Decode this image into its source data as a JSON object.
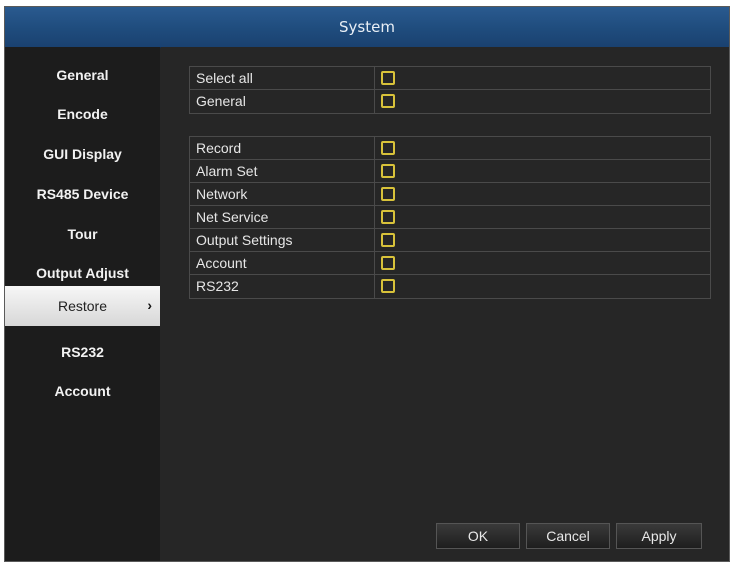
{
  "window": {
    "title": "System"
  },
  "sidebar": {
    "items": [
      {
        "label": "General"
      },
      {
        "label": "Encode"
      },
      {
        "label": "GUI Display"
      },
      {
        "label": "RS485 Device"
      },
      {
        "label": "Tour"
      },
      {
        "label": "Output Adjust"
      },
      {
        "label": "Restore",
        "active": true
      },
      {
        "label": "RS232"
      },
      {
        "label": "Account"
      }
    ],
    "active_chevron": "›"
  },
  "options_top": [
    {
      "label": "Select all",
      "checked": false
    },
    {
      "label": "General",
      "checked": false
    }
  ],
  "options_main": [
    {
      "label": "Record",
      "checked": false
    },
    {
      "label": "Alarm Set",
      "checked": false
    },
    {
      "label": "Network",
      "checked": false
    },
    {
      "label": "Net Service",
      "checked": false
    },
    {
      "label": "Output Settings",
      "checked": false
    },
    {
      "label": "Account",
      "checked": false
    },
    {
      "label": "RS232",
      "checked": false
    }
  ],
  "buttons": {
    "ok": "OK",
    "cancel": "Cancel",
    "apply": "Apply"
  },
  "colors": {
    "title_bar": "#1f4c7d",
    "checkbox": "#d8c23a",
    "background": "#262626"
  }
}
